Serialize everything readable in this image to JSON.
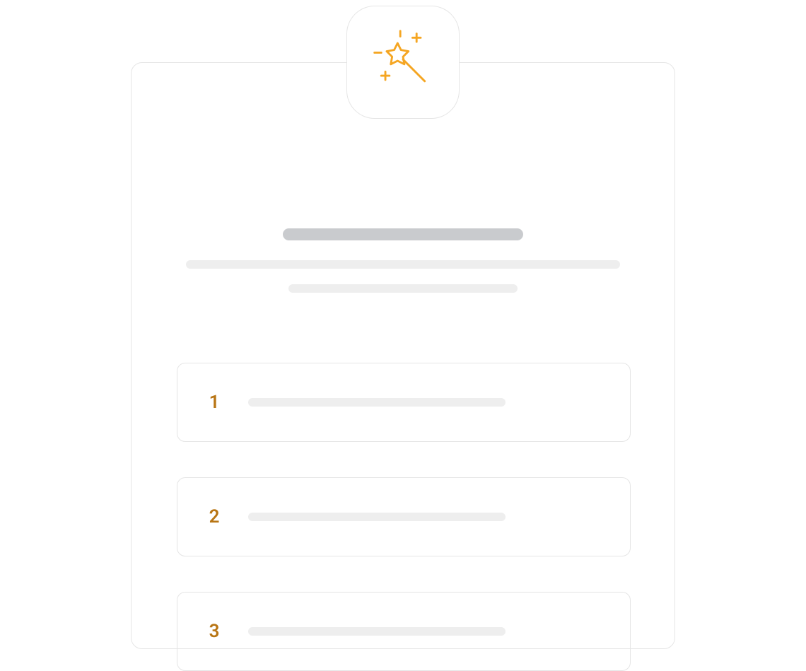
{
  "icon": "magic-wand-sparkles-icon",
  "accent_color": "#f5a623",
  "number_color": "#b87514",
  "steps": [
    {
      "number": "1"
    },
    {
      "number": "2"
    },
    {
      "number": "3"
    }
  ]
}
